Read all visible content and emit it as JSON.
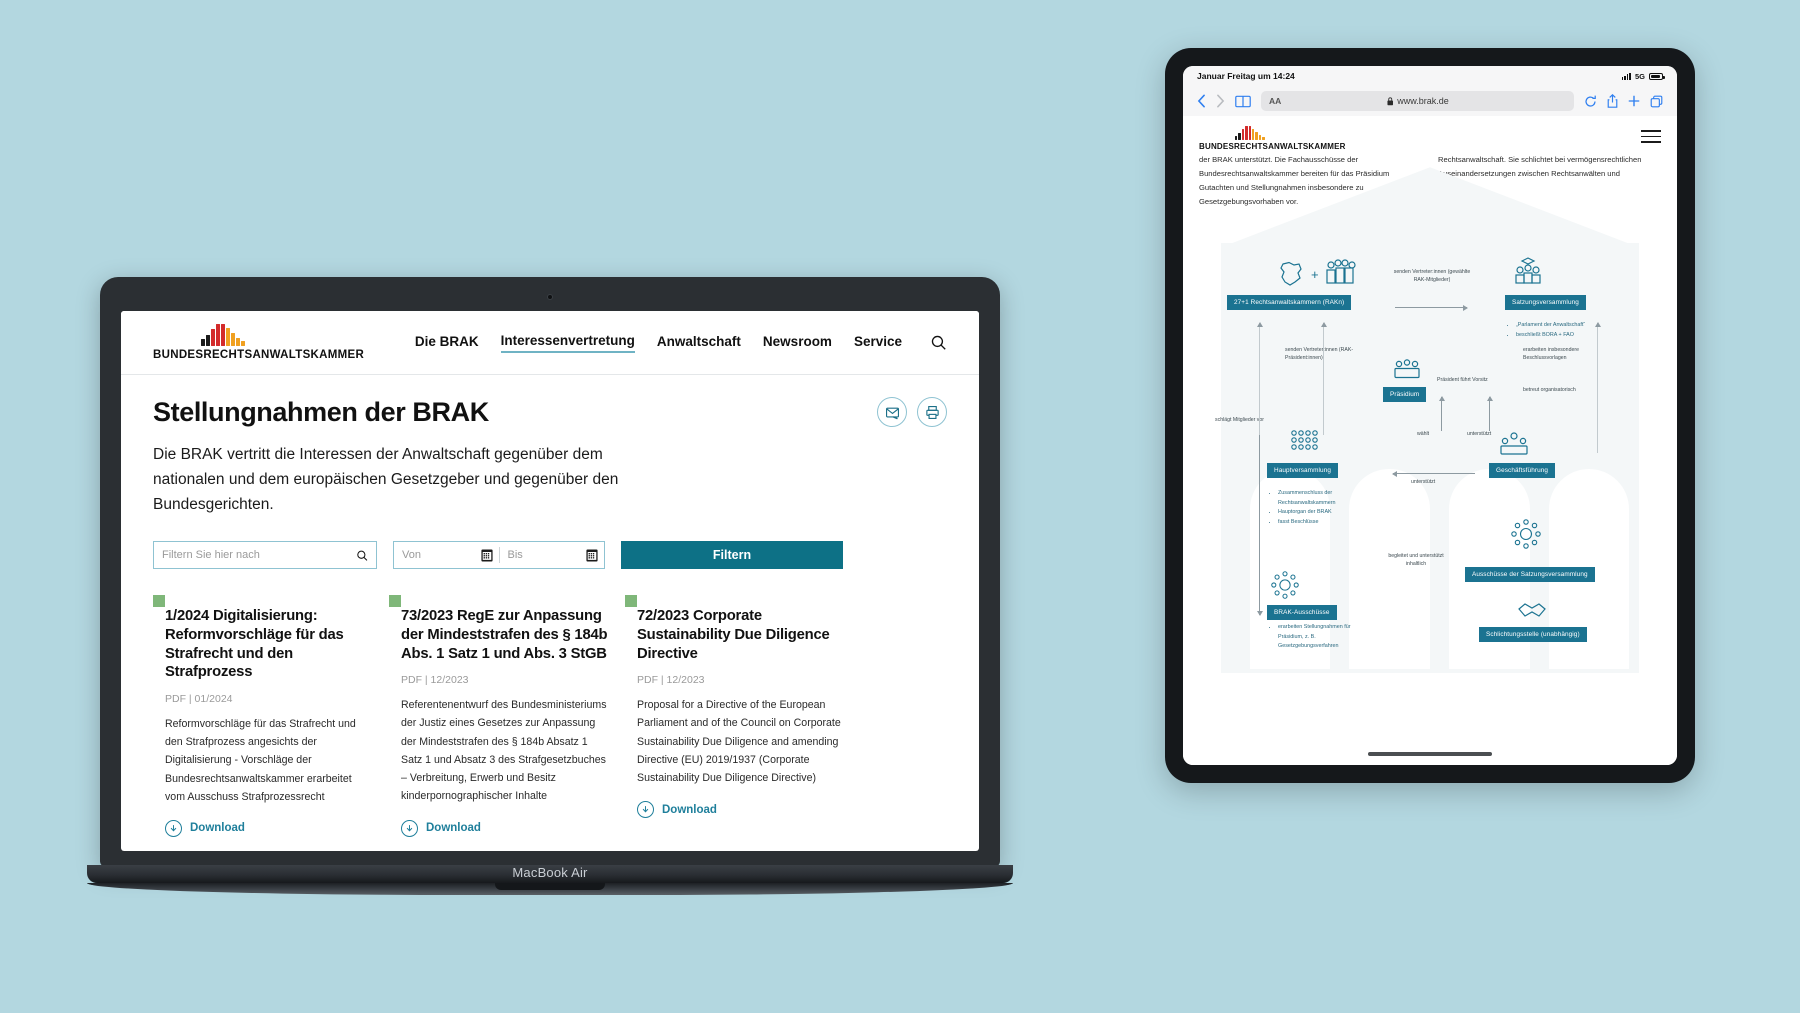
{
  "scene": {
    "background_color": "#b3d7e0"
  },
  "laptop": {
    "model_label": "MacBook Air",
    "site": {
      "brand": {
        "name": "BUNDESRECHTSANWALTSKAMMER",
        "logo_name": "brak-bar-logo"
      },
      "nav": [
        {
          "label": "Die BRAK",
          "active": false
        },
        {
          "label": "Interessenvertretung",
          "active": true
        },
        {
          "label": "Anwaltschaft",
          "active": false
        },
        {
          "label": "Newsroom",
          "active": false
        },
        {
          "label": "Service",
          "active": false
        }
      ],
      "search_icon": "search-icon",
      "page": {
        "title": "Stellungnahmen der BRAK",
        "intro": "Die BRAK vertritt die Interessen der Anwaltschaft gegenüber dem nationalen und dem europäischen Gesetzgeber und gegenüber den Bundesgerichten.",
        "actions": [
          {
            "name": "share-email-button",
            "icon": "envelope-share-icon"
          },
          {
            "name": "print-button",
            "icon": "printer-icon"
          }
        ],
        "filters": {
          "search_placeholder": "Filtern Sie hier nach",
          "search_value": "",
          "date_from_placeholder": "Von",
          "date_from_value": "",
          "date_to_placeholder": "Bis",
          "date_to_value": "",
          "submit_label": "Filtern",
          "submit_color": "#0d7186"
        },
        "cards": [
          {
            "title": "1/2024 Digitalisierung: Reformvorschläge für das Strafrecht und den Strafprozess",
            "meta": "PDF | 01/2024",
            "description": "Reformvorschläge für das Strafrecht und den Strafprozess angesichts der Digitalisierung - Vorschläge der Bundesrechtsanwaltskammer erarbeitet vom Ausschuss Strafprozessrecht",
            "download_label": "Download",
            "accent_color": "#7fb779"
          },
          {
            "title": "73/2023 RegE zur Anpassung der Mindeststrafen des § 184b Abs. 1 Satz 1 und Abs. 3 StGB",
            "meta": "PDF | 12/2023",
            "description": "Referentenentwurf des Bundesministeriums der Justiz eines Gesetzes zur Anpassung der Mindeststrafen des § 184b Absatz 1 Satz 1 und Absatz 3 des Strafgesetzbuches – Verbreitung, Erwerb und Besitz kinderpornographischer Inhalte",
            "download_label": "Download",
            "accent_color": "#7fb779"
          },
          {
            "title": "72/2023 Corporate Sustainability Due Diligence Directive",
            "meta": "PDF | 12/2023",
            "description": "Proposal for a Directive of the European Parliament and of the Council on Corporate Sustainability Due Diligence and amending Directive (EU) 2019/1937 (Corporate Sustainability Due Diligence Directive)",
            "download_label": "Download",
            "accent_color": "#7fb779"
          }
        ]
      }
    }
  },
  "tablet": {
    "status": {
      "datetime": "Januar Freitag um 14:24",
      "network": "5G"
    },
    "browser": {
      "back_icon": "chevron-left-icon",
      "forward_icon": "chevron-right-icon",
      "bookmarks_icon": "book-icon",
      "text_size_label": "AA",
      "lock_icon": "lock-icon",
      "url": "www.brak.de",
      "reload_icon": "reload-icon",
      "share_icon": "share-icon",
      "new_tab_icon": "plus-icon",
      "tabs_icon": "tabs-icon"
    },
    "site": {
      "brand": {
        "name": "BUNDESRECHTSANWALTSKAMMER",
        "logo_name": "brak-bar-logo"
      },
      "menu_icon": "hamburger-menu-icon",
      "text_columns": [
        "der BRAK unterstützt. Die Fachausschüsse der Bundesrechtsanwaltskammer bereiten für das Präsidium Gutachten und Stellungnahmen insbesondere zu Gesetzgebungsvorhaben vor.",
        "Rechtsanwaltschaft. Sie schlichtet bei vermögensrechtlichen Auseinandersetzungen zwischen Rechtsanwälten und Mandanten."
      ],
      "diagram": {
        "nodes": [
          {
            "label": "27+1 Rechtsanwaltskammern (RAKn)"
          },
          {
            "label": "Satzungsversammlung"
          },
          {
            "label": "Präsidium"
          },
          {
            "label": "Hauptversammlung"
          },
          {
            "label": "Geschäftsführung"
          },
          {
            "label": "BRAK-Ausschüsse"
          },
          {
            "label": "Ausschüsse der  Satzungsversammlung"
          },
          {
            "label": "Schlichtungsstelle (unabhängig)"
          }
        ],
        "notes": [
          "senden Vertreter:innen (gewählte RAK-Mitglieder)",
          "senden Vertreter:innen (RAK-Präsident:innen)",
          "erarbeiten insbesondere Beschlussvorlagen",
          "Präsident führt Vorsitz",
          "betreut organisatorisch",
          "schlägt Mitglieder vor",
          "wählt",
          "unterstützt",
          "unterstützt",
          "begleitet und unterstützt inhaltlich"
        ],
        "bullet_groups": [
          [
            "„Parlament der Anwaltschaft“",
            "beschließt BORA + FAO"
          ],
          [
            "Zusammenschluss der Rechtsanwaltskammern",
            "Hauptorgan der BRAK",
            "fasst Beschlüsse"
          ],
          [
            "erarbeiten Stellungnahmen für Präsidium, z. B. Gesetzgebungsverfahren"
          ]
        ],
        "accent_color": "#1b7391"
      }
    }
  }
}
